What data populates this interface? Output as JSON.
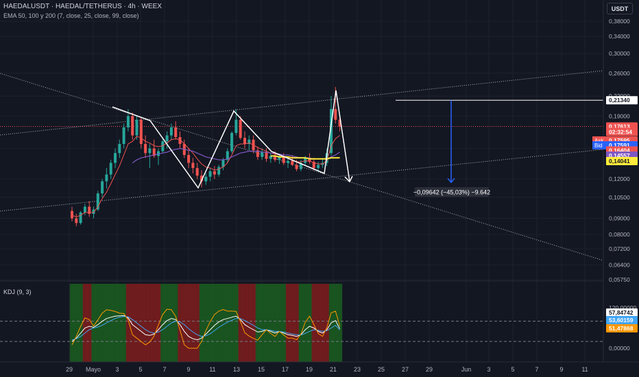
{
  "header": {
    "symbol": "HAEDALUSDT · HAEDAL/TETHERUS · 4h · WEEX",
    "indicator": "EMA 50, 100 y 200 (7, close, 25, close, 99, close)"
  },
  "currency_button": "USDT",
  "colors": {
    "background": "#131722",
    "up": "#26a69a",
    "down": "#ef5350",
    "ema7": "#ef5350",
    "ema25": "#7e57c2",
    "ema99": "#ffeb3b",
    "pattern": "#ffffff",
    "measure": "#2962ff",
    "kdj_k": "#ffffff",
    "kdj_d": "#42a5f5",
    "kdj_j": "#ff9800"
  },
  "chart_data": [
    {
      "type": "candlestick",
      "title": "HAEDALUSDT · HAEDAL/TETHERUS · 4h · WEEX",
      "ylim": [
        0.0575,
        0.4
      ],
      "y_scale": "log",
      "y_ticks": [
        "0,38000",
        "0,34000",
        "0,30000",
        "0,26000",
        "0,22000",
        "0,19000",
        "0,15000",
        "0,12000",
        "0,10500",
        "0,09000",
        "0,08000",
        "0,07200",
        "0,06400",
        "0,05750"
      ],
      "x_ticks": [
        "29",
        "Mayo",
        "3",
        "5",
        "7",
        "9",
        "11",
        "13",
        "15",
        "17",
        "19",
        "21",
        "23",
        "25",
        "27",
        "29",
        "Jun",
        "3",
        "5",
        "7",
        "9",
        "11"
      ],
      "price_labels": [
        {
          "text": "0,21340",
          "value": 0.2134,
          "color": "#ffffff",
          "text_color": "#131722"
        },
        {
          "text": "0,17613",
          "value": 0.17613,
          "color": "#ef5350",
          "text_color": "#ffffff"
        },
        {
          "text": "02:32:54",
          "value": 0.1692,
          "color": "#ef5350",
          "text_color": "#ffffff"
        },
        {
          "text": "0,17595",
          "value": 0.159,
          "color": "#ef5350",
          "text_color": "#ffffff",
          "tag": "Ask"
        },
        {
          "text": "0,17591",
          "value": 0.1535,
          "color": "#2962ff",
          "text_color": "#ffffff",
          "tag": "Bid"
        },
        {
          "text": "0,16404",
          "value": 0.1478,
          "color": "#ef5350",
          "text_color": "#ffffff"
        },
        {
          "text": "0,14557",
          "value": 0.1423,
          "color": "#7e57c2",
          "text_color": "#ffffff"
        },
        {
          "text": "0,14041",
          "value": 0.1368,
          "color": "#ffeb3b",
          "text_color": "#131722"
        }
      ],
      "measure_label": "−0,09642 (−45,03%) −9.642",
      "measure_from": 0.2134,
      "measure_to": 0.117,
      "candles": [
        [
          0.095,
          0.098,
          0.088,
          0.09
        ],
        [
          0.09,
          0.093,
          0.085,
          0.087
        ],
        [
          0.087,
          0.095,
          0.086,
          0.094
        ],
        [
          0.094,
          0.1,
          0.092,
          0.098
        ],
        [
          0.098,
          0.102,
          0.091,
          0.093
        ],
        [
          0.093,
          0.098,
          0.09,
          0.096
        ],
        [
          0.096,
          0.11,
          0.095,
          0.108
        ],
        [
          0.108,
          0.12,
          0.105,
          0.118
        ],
        [
          0.118,
          0.13,
          0.112,
          0.124
        ],
        [
          0.124,
          0.138,
          0.12,
          0.135
        ],
        [
          0.135,
          0.15,
          0.13,
          0.145
        ],
        [
          0.145,
          0.16,
          0.14,
          0.155
        ],
        [
          0.155,
          0.18,
          0.15,
          0.175
        ],
        [
          0.175,
          0.2,
          0.17,
          0.19
        ],
        [
          0.19,
          0.195,
          0.16,
          0.165
        ],
        [
          0.165,
          0.19,
          0.16,
          0.185
        ],
        [
          0.185,
          0.188,
          0.15,
          0.155
        ],
        [
          0.155,
          0.165,
          0.14,
          0.145
        ],
        [
          0.145,
          0.155,
          0.13,
          0.15
        ],
        [
          0.15,
          0.16,
          0.14,
          0.142
        ],
        [
          0.142,
          0.15,
          0.133,
          0.147
        ],
        [
          0.147,
          0.16,
          0.145,
          0.158
        ],
        [
          0.158,
          0.17,
          0.15,
          0.165
        ],
        [
          0.165,
          0.18,
          0.16,
          0.175
        ],
        [
          0.175,
          0.183,
          0.16,
          0.163
        ],
        [
          0.163,
          0.17,
          0.15,
          0.155
        ],
        [
          0.155,
          0.16,
          0.14,
          0.143
        ],
        [
          0.143,
          0.15,
          0.13,
          0.135
        ],
        [
          0.135,
          0.14,
          0.125,
          0.13
        ],
        [
          0.13,
          0.135,
          0.12,
          0.123
        ],
        [
          0.123,
          0.128,
          0.113,
          0.118
        ],
        [
          0.118,
          0.125,
          0.115,
          0.122
        ],
        [
          0.122,
          0.13,
          0.118,
          0.127
        ],
        [
          0.127,
          0.132,
          0.12,
          0.124
        ],
        [
          0.124,
          0.133,
          0.122,
          0.131
        ],
        [
          0.131,
          0.14,
          0.128,
          0.138
        ],
        [
          0.138,
          0.15,
          0.135,
          0.147
        ],
        [
          0.147,
          0.17,
          0.145,
          0.168
        ],
        [
          0.168,
          0.2,
          0.165,
          0.185
        ],
        [
          0.185,
          0.19,
          0.16,
          0.162
        ],
        [
          0.162,
          0.17,
          0.15,
          0.155
        ],
        [
          0.155,
          0.165,
          0.148,
          0.16
        ],
        [
          0.16,
          0.165,
          0.145,
          0.148
        ],
        [
          0.148,
          0.152,
          0.138,
          0.141
        ],
        [
          0.141,
          0.15,
          0.138,
          0.146
        ],
        [
          0.146,
          0.15,
          0.136,
          0.139
        ],
        [
          0.139,
          0.145,
          0.135,
          0.142
        ],
        [
          0.142,
          0.147,
          0.136,
          0.138
        ],
        [
          0.138,
          0.144,
          0.134,
          0.141
        ],
        [
          0.141,
          0.145,
          0.133,
          0.135
        ],
        [
          0.135,
          0.14,
          0.13,
          0.137
        ],
        [
          0.137,
          0.143,
          0.132,
          0.133
        ],
        [
          0.133,
          0.138,
          0.127,
          0.129
        ],
        [
          0.129,
          0.138,
          0.127,
          0.135
        ],
        [
          0.135,
          0.142,
          0.133,
          0.14
        ],
        [
          0.14,
          0.145,
          0.134,
          0.136
        ],
        [
          0.136,
          0.14,
          0.128,
          0.13
        ],
        [
          0.13,
          0.136,
          0.127,
          0.133
        ],
        [
          0.133,
          0.14,
          0.13,
          0.135
        ],
        [
          0.135,
          0.15,
          0.132,
          0.145
        ],
        [
          0.145,
          0.22,
          0.142,
          0.2
        ],
        [
          0.2,
          0.235,
          0.18,
          0.185
        ],
        [
          0.185,
          0.19,
          0.17,
          0.176
        ]
      ],
      "ema_fast": [
        0.092,
        0.091,
        0.092,
        0.094,
        0.094,
        0.094,
        0.098,
        0.104,
        0.109,
        0.116,
        0.124,
        0.132,
        0.143,
        0.155,
        0.158,
        0.164,
        0.162,
        0.158,
        0.156,
        0.153,
        0.152,
        0.153,
        0.156,
        0.16,
        0.161,
        0.16,
        0.155,
        0.15,
        0.145,
        0.139,
        0.134,
        0.131,
        0.13,
        0.128,
        0.129,
        0.131,
        0.135,
        0.143,
        0.153,
        0.155,
        0.155,
        0.156,
        0.154,
        0.151,
        0.149,
        0.147,
        0.145,
        0.144,
        0.143,
        0.141,
        0.14,
        0.138,
        0.136,
        0.136,
        0.137,
        0.137,
        0.135,
        0.134,
        0.134,
        0.137,
        0.153,
        0.161,
        0.165
      ],
      "ema_slow": [
        null,
        null,
        null,
        null,
        null,
        null,
        null,
        null,
        null,
        null,
        null,
        null,
        null,
        null,
        0.135,
        0.138,
        0.14,
        0.141,
        0.142,
        0.143,
        0.144,
        0.145,
        0.146,
        0.148,
        0.149,
        0.15,
        0.149,
        0.148,
        0.147,
        0.145,
        0.143,
        0.141,
        0.14,
        0.139,
        0.138,
        0.138,
        0.139,
        0.141,
        0.143,
        0.145,
        0.146,
        0.147,
        0.147,
        0.147,
        0.146,
        0.146,
        0.145,
        0.145,
        0.144,
        0.143,
        0.143,
        0.142,
        0.141,
        0.14,
        0.14,
        0.14,
        0.139,
        0.139,
        0.139,
        0.139,
        0.141,
        0.143,
        0.146
      ],
      "ema_long": [
        null,
        null,
        null,
        null,
        null,
        null,
        null,
        null,
        null,
        null,
        null,
        null,
        null,
        null,
        null,
        null,
        null,
        null,
        null,
        null,
        null,
        null,
        null,
        null,
        null,
        null,
        null,
        null,
        null,
        null,
        null,
        null,
        null,
        null,
        null,
        null,
        null,
        null,
        null,
        null,
        null,
        null,
        null,
        null,
        null,
        null,
        0.142,
        0.142,
        0.141,
        0.141,
        0.141,
        0.14,
        0.14,
        0.14,
        0.14,
        0.139,
        0.139,
        0.139,
        0.139,
        0.139,
        0.14,
        0.14,
        0.14
      ]
    },
    {
      "type": "line",
      "title": "KDJ (9, 3)",
      "ylim": [
        -10,
        130
      ],
      "y_ticks": [
        "120,00000",
        "80,00000",
        "0,00000"
      ],
      "levels": [
        80,
        20
      ],
      "value_labels": [
        {
          "text": "57,84742",
          "value": 57.84742,
          "color": "#ffffff",
          "text_color": "#131722"
        },
        {
          "text": "53,60159",
          "value": 53.60159,
          "color": "#42a5f5",
          "text_color": "#ffffff"
        },
        {
          "text": "51,47868",
          "value": 51.47868,
          "color": "#ff9800",
          "text_color": "#ffffff"
        }
      ],
      "series": [
        {
          "name": "K",
          "values": [
            20,
            30,
            45,
            60,
            65,
            62,
            70,
            80,
            88,
            92,
            95,
            96,
            97,
            90,
            70,
            60,
            50,
            40,
            38,
            42,
            55,
            70,
            82,
            88,
            85,
            70,
            50,
            35,
            28,
            25,
            30,
            42,
            55,
            68,
            78,
            85,
            88,
            92,
            95,
            85,
            70,
            62,
            55,
            48,
            50,
            55,
            50,
            45,
            50,
            45,
            40,
            38,
            35,
            40,
            55,
            65,
            60,
            50,
            45,
            55,
            75,
            82,
            58
          ]
        },
        {
          "name": "D",
          "values": [
            25,
            28,
            35,
            45,
            55,
            60,
            63,
            68,
            75,
            82,
            88,
            92,
            94,
            93,
            85,
            75,
            65,
            55,
            48,
            45,
            48,
            55,
            65,
            75,
            80,
            78,
            70,
            58,
            48,
            40,
            35,
            37,
            43,
            52,
            62,
            70,
            77,
            83,
            88,
            88,
            82,
            75,
            68,
            60,
            55,
            55,
            53,
            50,
            50,
            48,
            45,
            42,
            40,
            39,
            44,
            50,
            55,
            53,
            50,
            52,
            60,
            68,
            54
          ]
        },
        {
          "name": "J",
          "values": [
            10,
            35,
            65,
            90,
            85,
            66,
            84,
            104,
            114,
            112,
            109,
            104,
            103,
            84,
            40,
            30,
            20,
            10,
            18,
            36,
            69,
            100,
            116,
            114,
            95,
            54,
            10,
            0,
            0,
            0,
            20,
            52,
            79,
            100,
            110,
            115,
            110,
            110,
            109,
            79,
            46,
            36,
            29,
            24,
            40,
            55,
            44,
            35,
            50,
            39,
            30,
            30,
            25,
            42,
            77,
            95,
            70,
            44,
            35,
            61,
            105,
            110,
            66
          ]
        }
      ],
      "regions": [
        "green",
        "green",
        "green",
        "red",
        "red",
        "green",
        "green",
        "green",
        "green",
        "green",
        "green",
        "green",
        "green",
        "red",
        "red",
        "red",
        "red",
        "red",
        "red",
        "red",
        "red",
        "green",
        "green",
        "green",
        "green",
        "red",
        "red",
        "red",
        "red",
        "red",
        "green",
        "green",
        "green",
        "green",
        "green",
        "green",
        "green",
        "green",
        "green",
        "red",
        "red",
        "red",
        "red",
        "green",
        "green",
        "green",
        "green",
        "green",
        "green",
        "green",
        "red",
        "red",
        "red",
        "green",
        "green",
        "green",
        "red",
        "red",
        "red",
        "red",
        "green",
        "green",
        "green"
      ]
    }
  ]
}
